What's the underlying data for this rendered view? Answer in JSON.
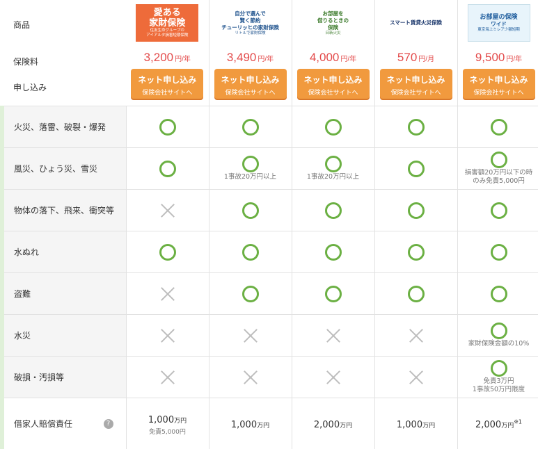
{
  "header": {
    "label_product": "商品",
    "label_fee": "保険料",
    "label_apply": "申し込み"
  },
  "products": [
    {
      "logo_lines": [
        "愛ある",
        "家財保険"
      ],
      "logo_sub": [
        "住友生命グループの",
        "アイアルタ損害短期保険"
      ],
      "price": "3,200",
      "unit": "円/年",
      "apply_main": "ネット申し込み",
      "apply_sub": "保険会社サイトへ"
    },
    {
      "logo_lines": [
        "自分で選んで",
        "賢く節約",
        "チューリッヒの家財保険"
      ],
      "logo_sub": [
        "リトルで家財保険"
      ],
      "price": "3,490",
      "unit": "円/年",
      "apply_main": "ネット申し込み",
      "apply_sub": "保険会社サイトへ"
    },
    {
      "logo_lines": [
        "お部屋を",
        "借りるときの",
        "保険"
      ],
      "logo_sub": [
        "日新火災"
      ],
      "price": "4,000",
      "unit": "円/年",
      "apply_main": "ネット申し込み",
      "apply_sub": "保険会社サイトへ"
    },
    {
      "logo_lines": [
        "スマート賃貸火災保険"
      ],
      "logo_sub": [],
      "price": "570",
      "unit": "円/月",
      "apply_main": "ネット申し込み",
      "apply_sub": "保険会社サイトへ"
    },
    {
      "logo_lines": [
        "お部屋の保険",
        "ワイド"
      ],
      "logo_sub": [
        "東京海上ミレア少額短期"
      ],
      "price": "9,500",
      "unit": "円/年",
      "apply_main": "ネット申し込み",
      "apply_sub": "保険会社サイトへ"
    }
  ],
  "rows": [
    {
      "label": "火災、落雷、破裂・爆発",
      "cells": [
        {
          "mark": "circle"
        },
        {
          "mark": "circle"
        },
        {
          "mark": "circle"
        },
        {
          "mark": "circle"
        },
        {
          "mark": "circle"
        }
      ]
    },
    {
      "label": "風災、ひょう災、雪災",
      "cells": [
        {
          "mark": "circle"
        },
        {
          "mark": "circle",
          "note": "1事故20万円以上"
        },
        {
          "mark": "circle",
          "note": "1事故20万円以上"
        },
        {
          "mark": "circle"
        },
        {
          "mark": "circle",
          "note": "損害額20万円以下の時\nのみ免責5,000円"
        }
      ]
    },
    {
      "label": "物体の落下、飛来、衝突等",
      "cells": [
        {
          "mark": "cross"
        },
        {
          "mark": "circle"
        },
        {
          "mark": "circle"
        },
        {
          "mark": "circle"
        },
        {
          "mark": "circle"
        }
      ]
    },
    {
      "label": "水ぬれ",
      "cells": [
        {
          "mark": "circle"
        },
        {
          "mark": "circle"
        },
        {
          "mark": "circle"
        },
        {
          "mark": "circle"
        },
        {
          "mark": "circle"
        }
      ]
    },
    {
      "label": "盗難",
      "cells": [
        {
          "mark": "cross"
        },
        {
          "mark": "circle"
        },
        {
          "mark": "circle"
        },
        {
          "mark": "circle"
        },
        {
          "mark": "circle"
        }
      ]
    },
    {
      "label": "水災",
      "cells": [
        {
          "mark": "cross"
        },
        {
          "mark": "cross"
        },
        {
          "mark": "cross"
        },
        {
          "mark": "cross"
        },
        {
          "mark": "circle",
          "note": "家財保険金額の10%"
        }
      ]
    },
    {
      "label": "破損・汚損等",
      "cells": [
        {
          "mark": "cross"
        },
        {
          "mark": "cross"
        },
        {
          "mark": "cross"
        },
        {
          "mark": "cross"
        },
        {
          "mark": "circle",
          "note": "免責3万円\n1事故50万円限度"
        }
      ]
    }
  ],
  "liability": {
    "label": "借家人賠償責任",
    "help": "?",
    "cells": [
      {
        "amount": "1,000",
        "unit": "万円",
        "sub": "免責5,000円"
      },
      {
        "amount": "1,000",
        "unit": "万円"
      },
      {
        "amount": "2,000",
        "unit": "万円"
      },
      {
        "amount": "1,000",
        "unit": "万円"
      },
      {
        "amount": "2,000",
        "unit": "万円",
        "sup": "※1"
      }
    ]
  },
  "colors": {
    "accent_green": "#6bb043",
    "button_orange": "#f19a3e",
    "price_red": "#e34a4a"
  }
}
